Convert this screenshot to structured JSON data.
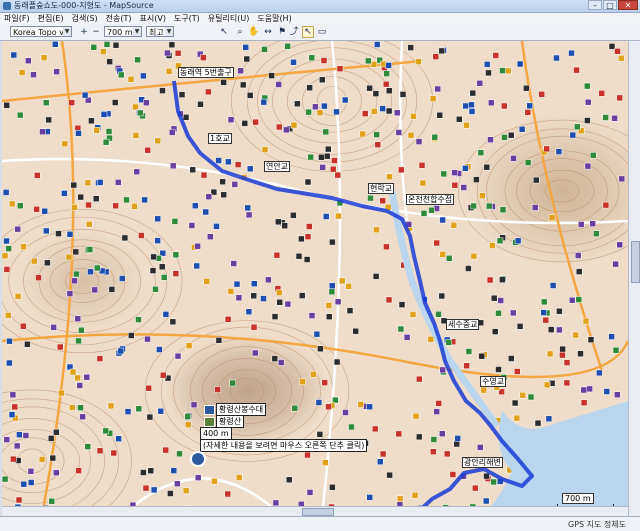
{
  "window": {
    "title": "동래플숲쇼도-000-지형도 - MapSource",
    "min": "–",
    "max": "□",
    "close": "✕"
  },
  "menu": [
    "파일(F)",
    "편집(E)",
    "검색(S)",
    "전송(T)",
    "표시(V)",
    "도구(T)",
    "유틸리티(U)",
    "도움말(H)"
  ],
  "toolbar": {
    "map_product": "Korea Topo v1",
    "zoom_level": "700 m",
    "detail": "최고",
    "zoom_in": "+",
    "zoom_out": "−"
  },
  "map": {
    "colors": {
      "route": "#1a3bd6",
      "terrain": "#efddc9",
      "sea": "#b9d6ee",
      "contour": "#b98966"
    },
    "labels": [
      {
        "id": "l1",
        "text": "동래역 5번출구"
      },
      {
        "id": "l2",
        "text": "1호교"
      },
      {
        "id": "l3",
        "text": "연안교"
      },
      {
        "id": "l4",
        "text": "현락교"
      },
      {
        "id": "l5",
        "text": "온천천합수점"
      },
      {
        "id": "l6",
        "text": "세수중교"
      },
      {
        "id": "l7",
        "text": "수영교"
      },
      {
        "id": "l8",
        "text": "광안리해변"
      }
    ],
    "info": {
      "name1": "황령산봉수대",
      "name2": "황령산",
      "distance": "400 m",
      "hint": "(자세한 내용을 보려면 마우스 오른쪽 단추 클릭)"
    },
    "scale": "700 m"
  },
  "status": {
    "gps": "GPS 지도 정체도"
  }
}
